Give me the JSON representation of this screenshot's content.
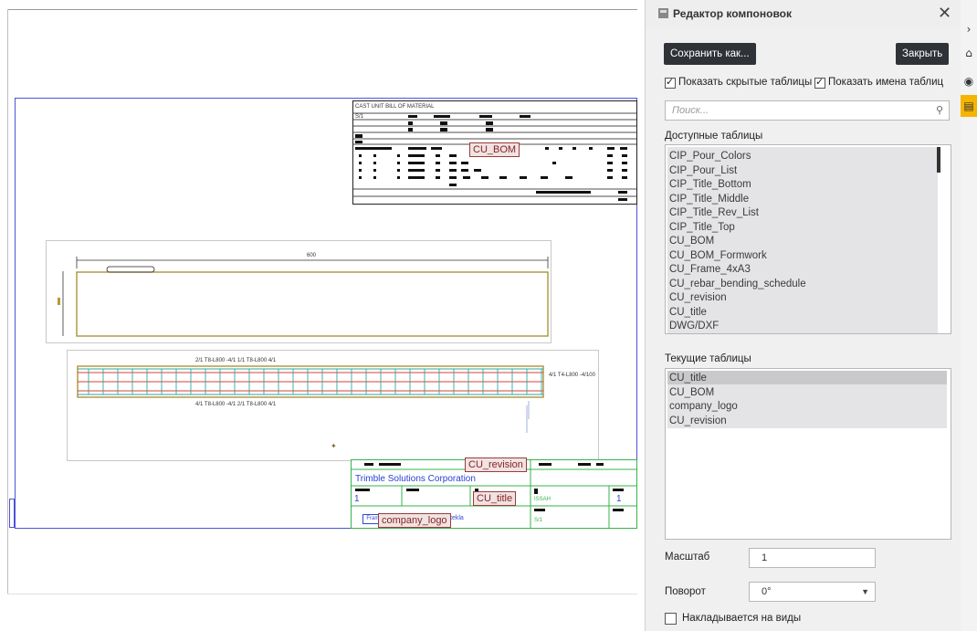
{
  "drawing": {
    "labels": {
      "bom": "CU_BOM",
      "revision": "CU_revision",
      "title": "CU_title",
      "logo": "company_logo"
    },
    "title_block": {
      "company": "Trimble Solutions Corporation",
      "sheet_no": "1",
      "rev_no": "1"
    }
  },
  "panel": {
    "title": "Редактор компоновок",
    "save_as_label": "Сохранить как...",
    "close_label": "Закрыть",
    "show_hidden_label": "Показать скрытые таблицы",
    "show_names_label": "Показать имена таблиц",
    "show_hidden_checked": true,
    "show_names_checked": true,
    "search_placeholder": "Поиск...",
    "available_header": "Доступные таблицы",
    "available_tables": [
      "CIP_Pour_Colors",
      "CIP_Pour_List",
      "CIP_Title_Bottom",
      "CIP_Title_Middle",
      "CIP_Title_Rev_List",
      "CIP_Title_Top",
      "CU_BOM",
      "CU_BOM_Formwork",
      "CU_Frame_4xA3",
      "CU_rebar_bending_schedule",
      "CU_revision",
      "CU_title",
      "DWG/DXF"
    ],
    "current_header": "Текущие таблицы",
    "current_tables": [
      "CU_title",
      "CU_BOM",
      "company_logo",
      "CU_revision"
    ],
    "scale_label": "Масштаб",
    "scale_value": "1",
    "rotation_label": "Поворот",
    "rotation_value": "0°",
    "overlay_label": "Накладывается на виды",
    "overlay_checked": false
  },
  "toolbar": {
    "icons": [
      "chevron-right-icon",
      "building-icon",
      "globe-icon",
      "table-layout-icon"
    ],
    "active_color": "#f5b400"
  }
}
